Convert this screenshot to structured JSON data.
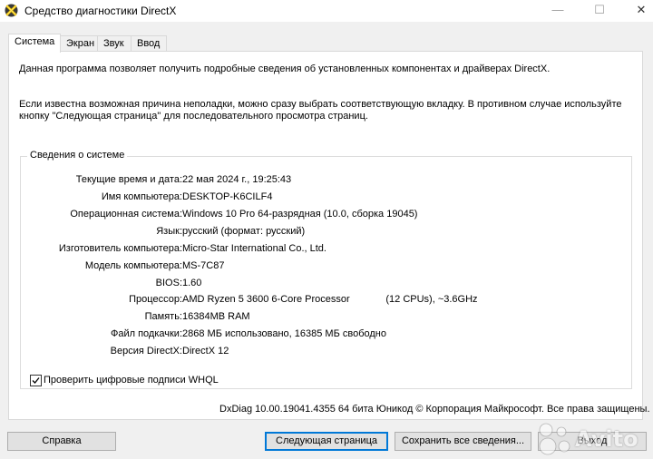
{
  "window": {
    "title": "Средство диагностики DirectX",
    "minimize": "—",
    "maximize": "☐",
    "close": "✕"
  },
  "tabs": [
    {
      "label": "Система",
      "active": true
    },
    {
      "label": "Экран",
      "active": false
    },
    {
      "label": "Звук",
      "active": false
    },
    {
      "label": "Ввод",
      "active": false
    }
  ],
  "intro": {
    "line1": "Данная программа позволяет получить подробные сведения об установленных компонентах и драйверах DirectX.",
    "line2": "Если известна возможная причина неполадки, можно сразу выбрать соответствующую вкладку. В противном случае используйте",
    "line3": "кнопку \"Следующая страница\" для последовательного просмотра страниц."
  },
  "system_info": {
    "group_title": "Сведения о системе",
    "rows": [
      {
        "label": "Текущие время и дата:",
        "value": "22 мая 2024 г., 19:25:43"
      },
      {
        "label": "Имя компьютера:",
        "value": "DESKTOP-K6CILF4"
      },
      {
        "label": "Операционная система:",
        "value": "Windows 10 Pro 64-разрядная (10.0, сборка 19045)"
      },
      {
        "label": "Язык:",
        "value": "русский (формат: русский)"
      },
      {
        "label": "Изготовитель компьютера:",
        "value": "Micro-Star International Co., Ltd."
      },
      {
        "label": "Модель компьютера:",
        "value": "MS-7C87"
      },
      {
        "label": "BIOS:",
        "value": "1.60"
      },
      {
        "label": "Процессор:",
        "value": "AMD Ryzen 5 3600 6-Core Processor             (12 CPUs), ~3.6GHz"
      },
      {
        "label": "Память:",
        "value": "16384MB RAM"
      },
      {
        "label": "Файл подкачки:",
        "value": "2868 МБ использовано, 16385 МБ свободно"
      },
      {
        "label": "Версия DirectX:",
        "value": "DirectX 12"
      }
    ]
  },
  "whql_checkbox": {
    "label": "Проверить цифровые подписи WHQL",
    "checked": true
  },
  "footer": "DxDiag 10.00.19041.4355 64 бита Юникод © Корпорация Майкрософт. Все права защищены.",
  "buttons": {
    "help": "Справка",
    "next_page": "Следующая страница",
    "save_all": "Сохранить все сведения...",
    "exit": "Выход"
  },
  "watermark": {
    "text": "Avito"
  },
  "colors": {
    "accent": "#0078d7",
    "panel_border": "#d9d9d9",
    "window_bg": "#f0f0f0"
  }
}
